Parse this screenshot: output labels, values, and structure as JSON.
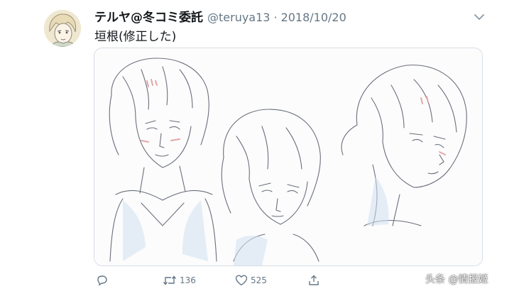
{
  "tweet": {
    "display_name": "テルヤ@冬コミ委託",
    "handle": "@teruya13",
    "separator": "·",
    "date": "2018/10/20",
    "text": "垣根(修正した)",
    "more_icon": "chevron-down-icon",
    "media": {
      "kind": "image",
      "description_icon": "sketch-image"
    }
  },
  "actions": {
    "reply": {
      "icon": "reply-icon",
      "count": ""
    },
    "retweet": {
      "icon": "retweet-icon",
      "count": "136"
    },
    "like": {
      "icon": "heart-icon",
      "count": "525"
    },
    "share": {
      "icon": "share-icon",
      "count": ""
    }
  },
  "watermark": {
    "text": "头条 @情报姬"
  },
  "colors": {
    "text": "#14171a",
    "secondary": "#657786",
    "border": "#d6dde3",
    "sketch_line": "#6a6f7a",
    "sketch_accent": "#e4a6a6",
    "sketch_shadow": "#b9d2ea"
  }
}
